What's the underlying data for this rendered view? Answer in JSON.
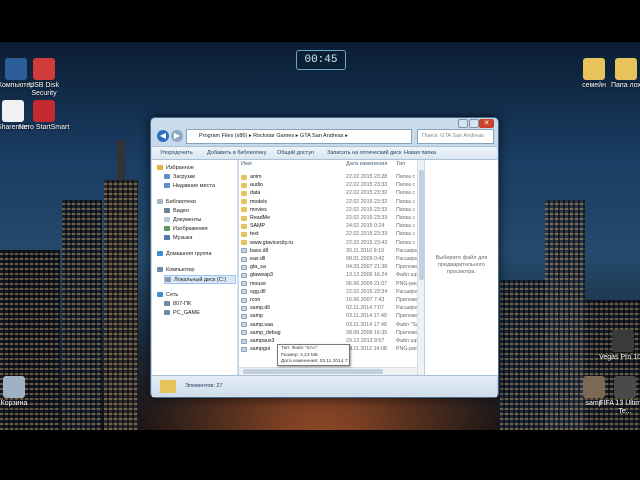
{
  "desktop": {
    "clock": "00:45",
    "icons_left": [
      {
        "label": "Компьютер",
        "icon": "computer-icon",
        "color": "#2c5f99"
      },
      {
        "label": "USB Disk Security",
        "icon": "usb-shield-icon",
        "color": "#d23b3b"
      },
      {
        "label": "Shareman",
        "icon": "panda-icon",
        "color": "#f1f1f1"
      },
      {
        "label": "Nero StartSmart",
        "icon": "nero-icon",
        "color": "#c5282f"
      },
      {
        "label": "Корзина",
        "icon": "recycle-bin-icon",
        "color": "#9fb2c4"
      }
    ],
    "icons_right": [
      {
        "label": "семейн",
        "icon": "folder-icon",
        "color": "#e8c25a"
      },
      {
        "label": "Папа лох",
        "icon": "folder-icon",
        "color": "#e8c25a"
      },
      {
        "label": "Vegas Pro 10.0",
        "icon": "vegas-icon",
        "color": "#3b3b3b"
      },
      {
        "label": "samp",
        "icon": "samp-icon",
        "color": "#7a6a55"
      },
      {
        "label": "FIFA 13 Ultimate Te...",
        "icon": "fifa-icon",
        "color": "#4a4a4a"
      }
    ]
  },
  "window": {
    "address": [
      "Program Files (x86)",
      "Rockstar Games",
      "GTA San Andreas"
    ],
    "search_placeholder": "Поиск: GTA San Andreas",
    "toolbar": [
      "Упорядочить",
      "Добавить в библиотеку",
      "Общий доступ",
      "Записать на оптический диск",
      "Новая папка"
    ],
    "nav": [
      {
        "label": "Избранное",
        "icon": "star-icon",
        "color": "#e3b33a",
        "indent": 0
      },
      {
        "label": "Загрузки",
        "icon": "downloads-icon",
        "color": "#5b8fc9",
        "indent": 1
      },
      {
        "label": "Недавние места",
        "icon": "recent-places-icon",
        "color": "#5b8fc9",
        "indent": 1
      },
      {
        "label": "Библиотеки",
        "icon": "libraries-icon",
        "color": "#9fb5c9",
        "indent": 0
      },
      {
        "label": "Видео",
        "icon": "video-icon",
        "color": "#6b7f92",
        "indent": 1
      },
      {
        "label": "Документы",
        "icon": "documents-icon",
        "color": "#b7c7d6",
        "indent": 1
      },
      {
        "label": "Изображения",
        "icon": "pictures-icon",
        "color": "#5c9a62",
        "indent": 1
      },
      {
        "label": "Музыка",
        "icon": "music-icon",
        "color": "#4d78b2",
        "indent": 1
      },
      {
        "label": "Домашняя группа",
        "icon": "homegroup-icon",
        "color": "#3d8fd1",
        "indent": 0
      },
      {
        "label": "Компьютер",
        "icon": "computer-icon",
        "color": "#6e8aa6",
        "indent": 0
      },
      {
        "label": "Локальный диск (C:)",
        "icon": "drive-icon",
        "color": "#8a9aa9",
        "indent": 1,
        "selected": true
      },
      {
        "label": "Сеть",
        "icon": "network-icon",
        "color": "#3d8fd1",
        "indent": 0
      },
      {
        "label": "807-ПК",
        "icon": "pc-icon",
        "color": "#6e8aa6",
        "indent": 1
      },
      {
        "label": "PC_GAME",
        "icon": "pc-icon",
        "color": "#6e8aa6",
        "indent": 1
      }
    ],
    "columns": {
      "name": "Имя",
      "date": "Дата изменения",
      "type": "Тип"
    },
    "files": [
      {
        "name": "anim",
        "date": "22.02.2015 23:28",
        "type": "Папка с фа",
        "kind": "folder"
      },
      {
        "name": "audio",
        "date": "22.02.2015 23:33",
        "type": "Папка с фа",
        "kind": "folder"
      },
      {
        "name": "data",
        "date": "22.02.2015 23:30",
        "type": "Папка с фа",
        "kind": "folder"
      },
      {
        "name": "models",
        "date": "22.02.2015 23:32",
        "type": "Папка с фа",
        "kind": "folder"
      },
      {
        "name": "movies",
        "date": "22.02.2015 23:33",
        "type": "Папка с фа",
        "kind": "folder"
      },
      {
        "name": "ReadMe",
        "date": "22.02.2015 23:33",
        "type": "Папка с фа",
        "kind": "folder"
      },
      {
        "name": "SAMP",
        "date": "24.02.2015 0:24",
        "type": "Папка с фа",
        "kind": "folder"
      },
      {
        "name": "text",
        "date": "22.02.2015 23:33",
        "type": "Папка с фа",
        "kind": "folder"
      },
      {
        "name": "www.gtavicecity.ru",
        "date": "22.02.2015 23:43",
        "type": "Папка с фа",
        "kind": "folder"
      },
      {
        "name": "bass.dll",
        "date": "30.11.2010 9:10",
        "type": "Расширени",
        "kind": "file"
      },
      {
        "name": "eax.dll",
        "date": "08.01.2009 0:42",
        "type": "Расширени",
        "kind": "file"
      },
      {
        "name": "gta_sa",
        "date": "04.03.2007 21:38",
        "type": "Приложени",
        "kind": "file"
      },
      {
        "name": "gtaweap3",
        "date": "13.12.2006 16:24",
        "type": "Файл шриф",
        "kind": "file"
      },
      {
        "name": "mouse",
        "date": "06.06.2009 21:07",
        "type": "PNG-рисун",
        "kind": "file"
      },
      {
        "name": "ogg.dll",
        "date": "22.02.2015 23:34",
        "type": "Расширени",
        "kind": "file"
      },
      {
        "name": "rcon",
        "date": "16.06.2007 7:43",
        "type": "Приложени",
        "kind": "file"
      },
      {
        "name": "samp.dll",
        "date": "02.11.2014 7:07",
        "type": "Расширени",
        "kind": "file"
      },
      {
        "name": "samp",
        "date": "03.11.2014 17:49",
        "type": "Приложени",
        "kind": "file"
      },
      {
        "name": "samp.saa",
        "date": "03.11.2014 17:49",
        "type": "Файл \"SAA\"",
        "kind": "file"
      },
      {
        "name": "samp_debug",
        "date": "28.08.2006 16:35",
        "type": "Приложени",
        "kind": "file"
      },
      {
        "name": "sampaux3",
        "date": "29.12.2013 9:57",
        "type": "Файл шриф",
        "kind": "file"
      },
      {
        "name": "sampgui",
        "date": "09.11.2012 14:08",
        "type": "PNG-рисун",
        "kind": "file"
      }
    ],
    "preview_text": "Выберите файл для предварительного просмотра.",
    "status_text": "Элементов: 27",
    "tooltip": [
      "Тип: Файл \"SAA\"",
      "Размер: 2,23 МБ",
      "Дата изменения: 03.11.2014 7:23"
    ]
  }
}
